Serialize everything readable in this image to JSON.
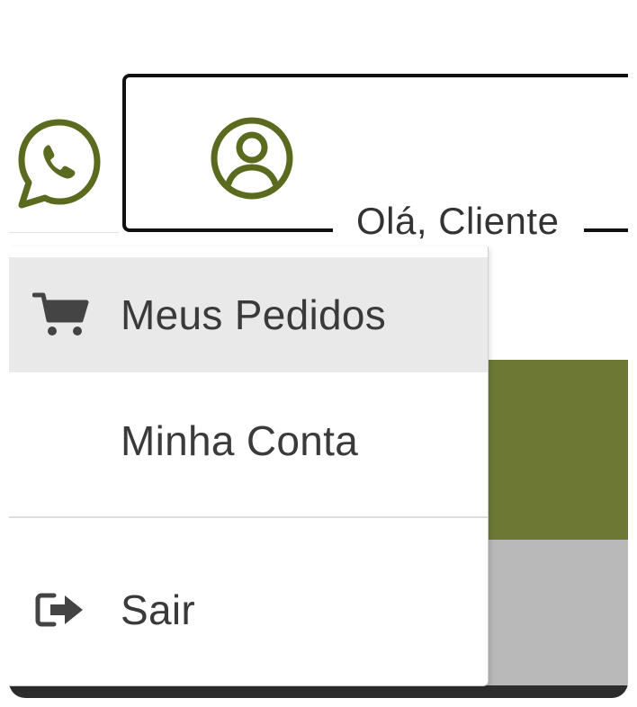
{
  "header": {
    "greeting": "Olá, Cliente",
    "whatsapp_icon": "whatsapp-icon",
    "account_icon": "user-circle-icon"
  },
  "menu": {
    "items": [
      {
        "label": "Meus Pedidos",
        "icon": "cart-icon",
        "active": true
      },
      {
        "label": "Minha Conta",
        "icon": ""
      },
      {
        "label": "Sair",
        "icon": "logout-icon"
      }
    ]
  },
  "colors": {
    "brand_olive": "#6c7833",
    "icon_olive": "#5a6a1e",
    "text": "#3a3a3a",
    "active_bg": "#e9e9e9"
  }
}
